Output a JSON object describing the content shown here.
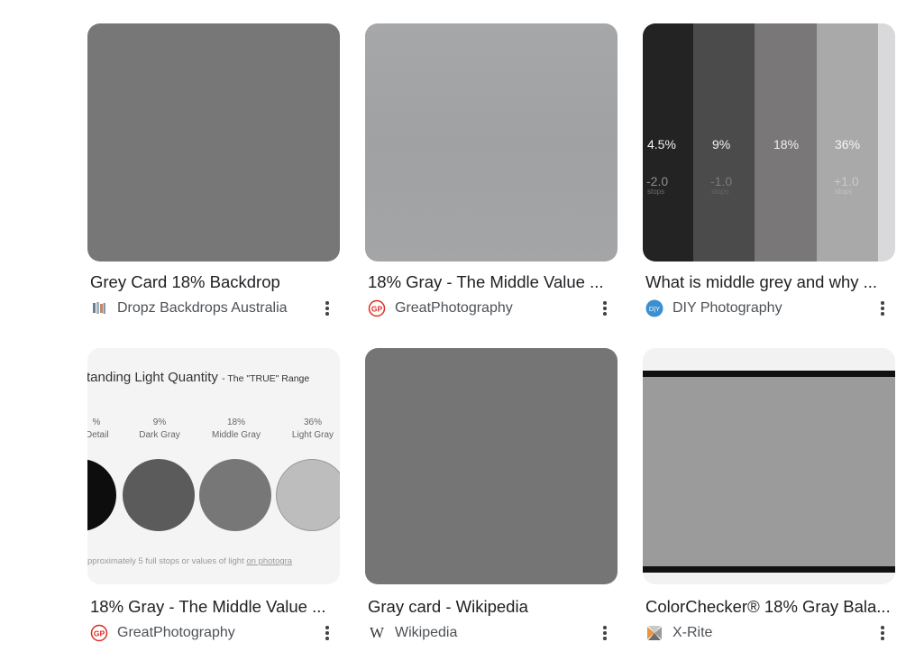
{
  "results": [
    {
      "title": "Grey Card 18% Backdrop",
      "source": "Dropz Backdrops Australia",
      "favicon": "dropz-icon"
    },
    {
      "title": "18% Gray - The Middle Value ...",
      "source": "GreatPhotography",
      "favicon": "gp-icon"
    },
    {
      "title": "What is middle grey and why ...",
      "source": "DIY Photography",
      "favicon": "diy-icon"
    },
    {
      "title": "18% Gray - The Middle Value ...",
      "source": "GreatPhotography",
      "favicon": "gp-icon"
    },
    {
      "title": "Gray card - Wikipedia",
      "source": "Wikipedia",
      "favicon": "wikipedia-icon"
    },
    {
      "title": "ColorChecker® 18% Gray Bala...",
      "source": "X-Rite",
      "favicon": "xrite-icon"
    }
  ],
  "stops_image": {
    "labels": [
      "4.5%",
      "9%",
      "18%",
      "36%"
    ],
    "stops": [
      "-2.0",
      "-1.0",
      "",
      "+1.0"
    ],
    "stops_word": "stops"
  },
  "light_image": {
    "heading": "tanding Light Quantity",
    "subheading": "- The \"TRUE\" Range",
    "labels": [
      [
        "%",
        "Detail"
      ],
      [
        "9%",
        "Dark Gray"
      ],
      [
        "18%",
        "Middle Gray"
      ],
      [
        "36%",
        "Light Gray"
      ]
    ],
    "footer": "pproximately 5 full stops or values of light",
    "footer_link": "on photogra"
  },
  "favicons": {
    "gp_text": "GP",
    "diy_text": "D|Y",
    "wiki_text": "W"
  }
}
